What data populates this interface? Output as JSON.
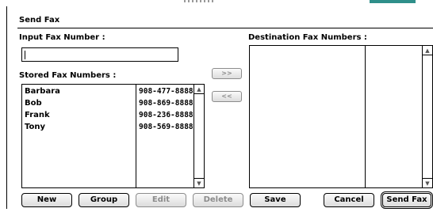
{
  "window": {
    "title": "Send Fax"
  },
  "input_fax": {
    "label": "Input Fax Number :",
    "value": ""
  },
  "stored": {
    "label": "Stored Fax Numbers :",
    "rows": [
      {
        "name": "Barbara",
        "number": "908-477-8888"
      },
      {
        "name": "Bob",
        "number": "908-869-8888"
      },
      {
        "name": "Frank",
        "number": "908-236-8888"
      },
      {
        "name": "Tony",
        "number": "908-569-8888"
      }
    ]
  },
  "transfer": {
    "add_label": ">>",
    "remove_label": "<<"
  },
  "destination": {
    "label": "Destination Fax Numbers :"
  },
  "buttons": {
    "new": "New",
    "group": "Group",
    "edit": "Edit",
    "delete": "Delete",
    "save": "Save",
    "cancel": "Cancel",
    "send_fax": "Send Fax"
  }
}
